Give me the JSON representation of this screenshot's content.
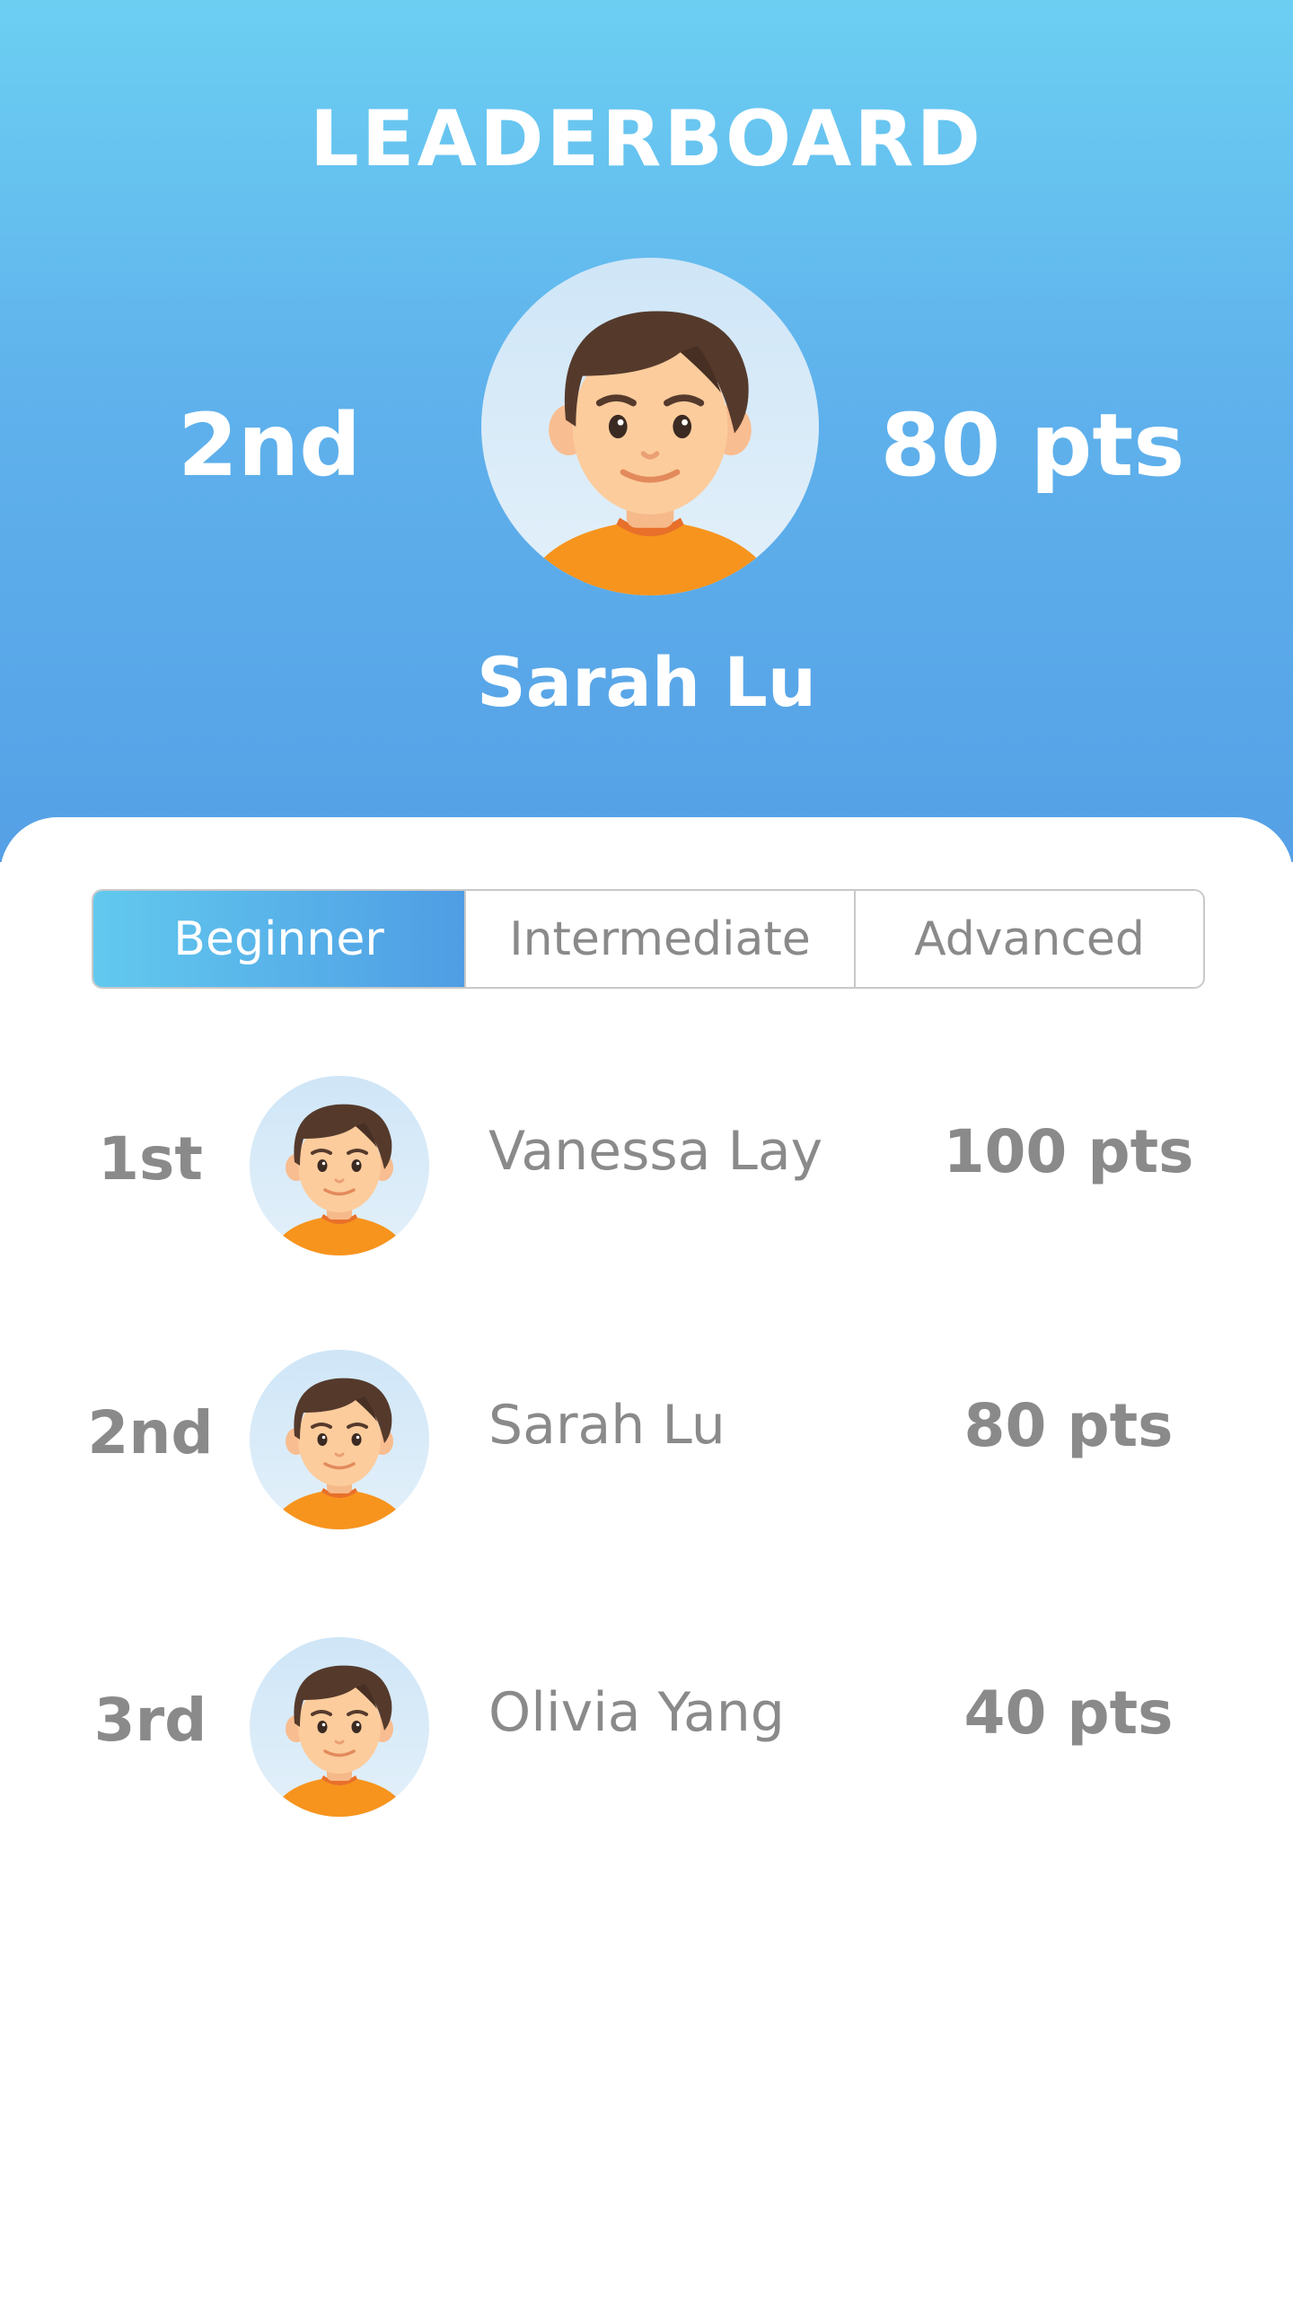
{
  "header": {
    "title": "LEADERBOARD",
    "current_user": {
      "rank": "2nd",
      "points": "80 pts",
      "name": "Sarah Lu",
      "avatar_icon": "boy-avatar-icon"
    }
  },
  "tabs": [
    {
      "label": "Beginner",
      "selected": true
    },
    {
      "label": "Intermediate",
      "selected": false
    },
    {
      "label": "Advanced",
      "selected": false
    }
  ],
  "leaderboard": [
    {
      "rank": "1st",
      "name": "Vanessa Lay",
      "points": "100 pts",
      "avatar_icon": "boy-avatar-icon"
    },
    {
      "rank": "2nd",
      "name": "Sarah Lu",
      "points": "80 pts",
      "avatar_icon": "boy-avatar-icon"
    },
    {
      "rank": "3rd",
      "name": "Olivia Yang",
      "points": "40 pts",
      "avatar_icon": "boy-avatar-icon"
    }
  ],
  "colors": {
    "header_gradient_top": "#6ccff2",
    "header_gradient_bottom": "#55a0e6",
    "tab_active_start": "#62c9ee",
    "tab_active_end": "#4f9de4",
    "text_gray": "#8a8a8a",
    "avatar_bg": "#d9ecf8",
    "shirt": "#f7941d",
    "hair": "#553a2c",
    "skin": "#fccc9c"
  }
}
